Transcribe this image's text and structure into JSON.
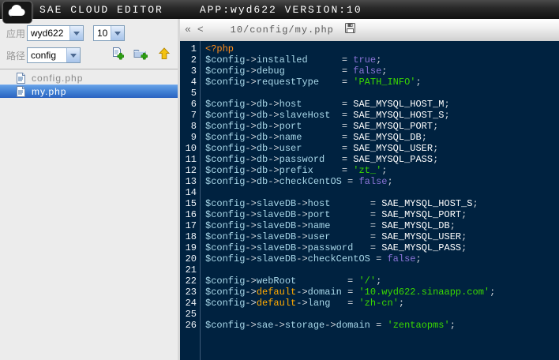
{
  "titlebar": {
    "title": "SAE CLOUD EDITOR",
    "app_info": "APP:wyd622 VERSION:10"
  },
  "icons": {
    "logo": "cloud",
    "new_file": "document-with-plus",
    "new_folder": "folder-with-plus",
    "parent_dir": "up-arrow",
    "file": "document",
    "save": "floppy-disk",
    "collapse": "double-chevron-left",
    "scroll_left": "chevron-left",
    "select_arrow": "chevron-down"
  },
  "sidebar": {
    "app_label": "应用",
    "app_select": "wyd622",
    "version_select": "10",
    "path_label": "路径",
    "path_select": "config",
    "files": [
      {
        "name": "config.php",
        "selected": false
      },
      {
        "name": "my.php",
        "selected": true
      }
    ]
  },
  "tabbar": {
    "collapse_glyph": "«",
    "scroll_left_glyph": "<",
    "tab_label": "10/config/my.php"
  },
  "editor": {
    "colors": {
      "editor_bg": "#002240",
      "gutter_text": "#eef3f8",
      "gutter_line": "#3d5a77",
      "php_tag": "#ff8c1a",
      "variable": "#a8d7e8",
      "operator": "#d2d6da",
      "constant": "#ffffff",
      "string": "#3ad900",
      "boolean": "#8b74d8",
      "keyword": "#ffaa00"
    },
    "lines": [
      [
        [
          "t",
          "<?php"
        ]
      ],
      [
        [
          "v",
          "$config"
        ],
        [
          "o",
          "->"
        ],
        [
          "v",
          "installed"
        ],
        [
          "o",
          "      = "
        ],
        [
          "b",
          "true"
        ],
        [
          "o",
          ";"
        ]
      ],
      [
        [
          "v",
          "$config"
        ],
        [
          "o",
          "->"
        ],
        [
          "v",
          "debug"
        ],
        [
          "o",
          "          = "
        ],
        [
          "b",
          "false"
        ],
        [
          "o",
          ";"
        ]
      ],
      [
        [
          "v",
          "$config"
        ],
        [
          "o",
          "->"
        ],
        [
          "v",
          "requestType"
        ],
        [
          "o",
          "    = "
        ],
        [
          "s",
          "'PATH_INFO'"
        ],
        [
          "o",
          ";"
        ]
      ],
      [],
      [
        [
          "v",
          "$config"
        ],
        [
          "o",
          "->"
        ],
        [
          "v",
          "db"
        ],
        [
          "o",
          "->"
        ],
        [
          "v",
          "host"
        ],
        [
          "o",
          "       = "
        ],
        [
          "c",
          "SAE_MYSQL_HOST_M"
        ],
        [
          "o",
          ";"
        ]
      ],
      [
        [
          "v",
          "$config"
        ],
        [
          "o",
          "->"
        ],
        [
          "v",
          "db"
        ],
        [
          "o",
          "->"
        ],
        [
          "v",
          "slaveHost"
        ],
        [
          "o",
          "  = "
        ],
        [
          "c",
          "SAE_MYSQL_HOST_S"
        ],
        [
          "o",
          ";"
        ]
      ],
      [
        [
          "v",
          "$config"
        ],
        [
          "o",
          "->"
        ],
        [
          "v",
          "db"
        ],
        [
          "o",
          "->"
        ],
        [
          "v",
          "port"
        ],
        [
          "o",
          "       = "
        ],
        [
          "c",
          "SAE_MYSQL_PORT"
        ],
        [
          "o",
          ";"
        ]
      ],
      [
        [
          "v",
          "$config"
        ],
        [
          "o",
          "->"
        ],
        [
          "v",
          "db"
        ],
        [
          "o",
          "->"
        ],
        [
          "v",
          "name"
        ],
        [
          "o",
          "       = "
        ],
        [
          "c",
          "SAE_MYSQL_DB"
        ],
        [
          "o",
          ";"
        ]
      ],
      [
        [
          "v",
          "$config"
        ],
        [
          "o",
          "->"
        ],
        [
          "v",
          "db"
        ],
        [
          "o",
          "->"
        ],
        [
          "v",
          "user"
        ],
        [
          "o",
          "       = "
        ],
        [
          "c",
          "SAE_MYSQL_USER"
        ],
        [
          "o",
          ";"
        ]
      ],
      [
        [
          "v",
          "$config"
        ],
        [
          "o",
          "->"
        ],
        [
          "v",
          "db"
        ],
        [
          "o",
          "->"
        ],
        [
          "v",
          "password"
        ],
        [
          "o",
          "   = "
        ],
        [
          "c",
          "SAE_MYSQL_PASS"
        ],
        [
          "o",
          ";"
        ]
      ],
      [
        [
          "v",
          "$config"
        ],
        [
          "o",
          "->"
        ],
        [
          "v",
          "db"
        ],
        [
          "o",
          "->"
        ],
        [
          "v",
          "prefix"
        ],
        [
          "o",
          "     = "
        ],
        [
          "s",
          "'zt_'"
        ],
        [
          "o",
          ";"
        ]
      ],
      [
        [
          "v",
          "$config"
        ],
        [
          "o",
          "->"
        ],
        [
          "v",
          "db"
        ],
        [
          "o",
          "->"
        ],
        [
          "v",
          "checkCentOS"
        ],
        [
          "o",
          " = "
        ],
        [
          "b",
          "false"
        ],
        [
          "o",
          ";"
        ]
      ],
      [],
      [
        [
          "v",
          "$config"
        ],
        [
          "o",
          "->"
        ],
        [
          "v",
          "slaveDB"
        ],
        [
          "o",
          "->"
        ],
        [
          "v",
          "host"
        ],
        [
          "o",
          "       = "
        ],
        [
          "c",
          "SAE_MYSQL_HOST_S"
        ],
        [
          "o",
          ";"
        ]
      ],
      [
        [
          "v",
          "$config"
        ],
        [
          "o",
          "->"
        ],
        [
          "v",
          "slaveDB"
        ],
        [
          "o",
          "->"
        ],
        [
          "v",
          "port"
        ],
        [
          "o",
          "       = "
        ],
        [
          "c",
          "SAE_MYSQL_PORT"
        ],
        [
          "o",
          ";"
        ]
      ],
      [
        [
          "v",
          "$config"
        ],
        [
          "o",
          "->"
        ],
        [
          "v",
          "slaveDB"
        ],
        [
          "o",
          "->"
        ],
        [
          "v",
          "name"
        ],
        [
          "o",
          "       = "
        ],
        [
          "c",
          "SAE_MYSQL_DB"
        ],
        [
          "o",
          ";"
        ]
      ],
      [
        [
          "v",
          "$config"
        ],
        [
          "o",
          "->"
        ],
        [
          "v",
          "slaveDB"
        ],
        [
          "o",
          "->"
        ],
        [
          "v",
          "user"
        ],
        [
          "o",
          "       = "
        ],
        [
          "c",
          "SAE_MYSQL_USER"
        ],
        [
          "o",
          ";"
        ]
      ],
      [
        [
          "v",
          "$config"
        ],
        [
          "o",
          "->"
        ],
        [
          "v",
          "slaveDB"
        ],
        [
          "o",
          "->"
        ],
        [
          "v",
          "password"
        ],
        [
          "o",
          "   = "
        ],
        [
          "c",
          "SAE_MYSQL_PASS"
        ],
        [
          "o",
          ";"
        ]
      ],
      [
        [
          "v",
          "$config"
        ],
        [
          "o",
          "->"
        ],
        [
          "v",
          "slaveDB"
        ],
        [
          "o",
          "->"
        ],
        [
          "v",
          "checkCentOS"
        ],
        [
          "o",
          " = "
        ],
        [
          "b",
          "false"
        ],
        [
          "o",
          ";"
        ]
      ],
      [],
      [
        [
          "v",
          "$config"
        ],
        [
          "o",
          "->"
        ],
        [
          "v",
          "webRoot"
        ],
        [
          "o",
          "         = "
        ],
        [
          "s",
          "'/'"
        ],
        [
          "o",
          ";"
        ]
      ],
      [
        [
          "v",
          "$config"
        ],
        [
          "o",
          "->"
        ],
        [
          "k",
          "default"
        ],
        [
          "o",
          "->"
        ],
        [
          "v",
          "domain"
        ],
        [
          "o",
          " = "
        ],
        [
          "s",
          "'10.wyd622.sinaapp.com'"
        ],
        [
          "o",
          ";"
        ]
      ],
      [
        [
          "v",
          "$config"
        ],
        [
          "o",
          "->"
        ],
        [
          "k",
          "default"
        ],
        [
          "o",
          "->"
        ],
        [
          "v",
          "lang"
        ],
        [
          "o",
          "   = "
        ],
        [
          "s",
          "'zh-cn'"
        ],
        [
          "o",
          ";"
        ]
      ],
      [],
      [
        [
          "v",
          "$config"
        ],
        [
          "o",
          "->"
        ],
        [
          "v",
          "sae"
        ],
        [
          "o",
          "->"
        ],
        [
          "v",
          "storage"
        ],
        [
          "o",
          "->"
        ],
        [
          "v",
          "domain"
        ],
        [
          "o",
          " = "
        ],
        [
          "s",
          "'zentaopms'"
        ],
        [
          "o",
          ";"
        ]
      ]
    ]
  }
}
